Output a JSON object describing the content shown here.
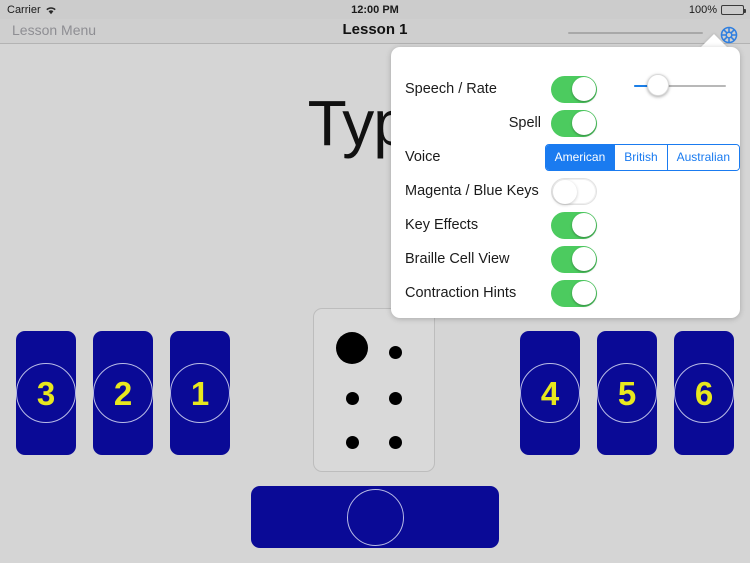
{
  "statusbar": {
    "carrier": "Carrier",
    "time": "12:00 PM",
    "battery_percent": "100%",
    "wifi_icon": "wifi-icon",
    "battery_icon": "battery-icon"
  },
  "navbar": {
    "back_label": "Lesson Menu",
    "title": "Lesson 1",
    "gear_icon": "gear-icon",
    "slider_name": "nav-slider"
  },
  "main": {
    "prompt_word": "Type"
  },
  "settings": {
    "rows": [
      {
        "label": "Speech / Rate",
        "control": "toggle",
        "state": "on",
        "align": "left"
      },
      {
        "label": "Spell",
        "control": "toggle",
        "state": "on",
        "align": "right"
      },
      {
        "label": "Voice",
        "control": "segmented",
        "align": "left"
      },
      {
        "label": "Magenta / Blue Keys",
        "control": "toggle",
        "state": "off",
        "align": "left"
      },
      {
        "label": "Key Effects",
        "control": "toggle",
        "state": "on",
        "align": "left"
      },
      {
        "label": "Braille Cell View",
        "control": "toggle",
        "state": "on",
        "align": "left"
      },
      {
        "label": "Contraction Hints",
        "control": "toggle",
        "state": "on",
        "align": "left"
      }
    ],
    "voice_options": [
      "American",
      "British",
      "Australian"
    ],
    "voice_selected": "American",
    "rate_slider": {
      "value_percent": 25,
      "track_color": "#b8b8b8",
      "fill_color": "#1b7fe8"
    },
    "toggle_on_color": "#4ccb5f",
    "accent_color": "#1a7bf0"
  },
  "braille": {
    "name": "braille-cell",
    "dots": [
      {
        "position": "dot-1",
        "filled": true,
        "large": true
      },
      {
        "position": "dot-4",
        "filled": false,
        "large": false
      },
      {
        "position": "dot-2",
        "filled": false,
        "large": false
      },
      {
        "position": "dot-5",
        "filled": false,
        "large": false
      },
      {
        "position": "dot-3",
        "filled": false,
        "large": false
      },
      {
        "position": "dot-6",
        "filled": false,
        "large": false
      }
    ]
  },
  "keyboard": {
    "key_color": "#0a0a96",
    "number_color": "#e8e81e",
    "left_keys": [
      "3",
      "2",
      "1"
    ],
    "right_keys": [
      "4",
      "5",
      "6"
    ],
    "spacebar_label": ""
  }
}
